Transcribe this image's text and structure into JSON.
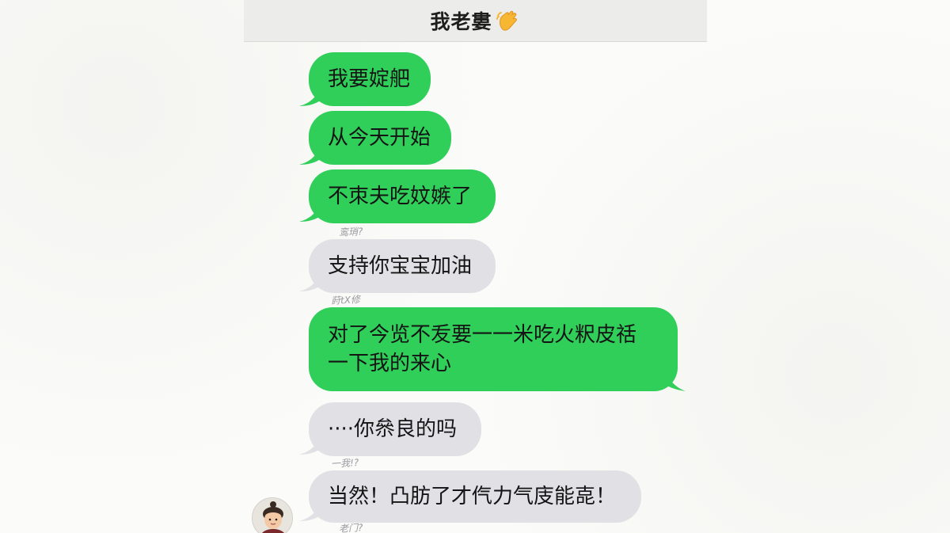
{
  "header": {
    "title": "我老婁",
    "emoji_icon": "hand-wave-icon"
  },
  "messages": [
    {
      "id": "m1",
      "side": "sent",
      "text": "我要婝舥"
    },
    {
      "id": "m2",
      "side": "sent",
      "text": "从今天开始"
    },
    {
      "id": "m3",
      "side": "sent",
      "text": "不朿夫吃妏嫉了"
    },
    {
      "id": "m4",
      "side": "received",
      "text": "支持你宝宝加油",
      "above_note": "鸾琑?"
    },
    {
      "id": "m5",
      "side": "sent",
      "lines": [
        "对了今览不叐要一一米吃火粎皮䄆",
        "一下我的来心"
      ],
      "above_note": "莳tX修"
    },
    {
      "id": "m6",
      "side": "received",
      "text": "····你㕘良的吗"
    },
    {
      "id": "m7",
      "side": "received",
      "text": "当然！凸肪了才㐹力气庋能㖛！",
      "above_note": "一我!?",
      "below_note": "老门?"
    }
  ],
  "colors": {
    "sent_bubble": "#2fcf5a",
    "received_bubble": "#e1e1e5",
    "header_bg": "#ececea"
  }
}
